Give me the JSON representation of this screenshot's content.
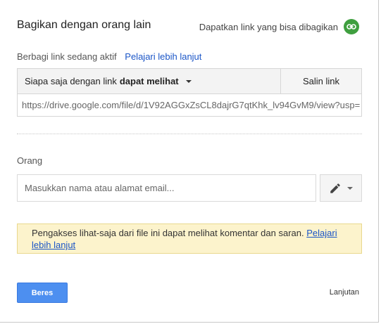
{
  "dialog": {
    "title": "Bagikan dengan orang lain",
    "get_link_label": "Dapatkan link yang bisa dibagikan",
    "link_icon_color": "#3f9f3f"
  },
  "link_sharing": {
    "status": "Berbagi link sedang aktif",
    "learn_more": "Pelajari lebih lanjut",
    "access_prefix": "Siapa saja dengan link",
    "access_level": "dapat melihat",
    "copy_button": "Salin link",
    "url": "https://drive.google.com/file/d/1V92AGGxZsCL8dajrG7qtKhk_lv94GvM9/view?usp="
  },
  "people": {
    "label": "Orang",
    "placeholder": "Masukkan nama atau alamat email..."
  },
  "notice": {
    "text": "Pengakses lihat-saja dari file ini dapat melihat komentar dan saran.",
    "link": "Pelajari lebih lanjut",
    "background": "#fcf3cc"
  },
  "footer": {
    "done_button": "Beres",
    "advanced_link": "Lanjutan",
    "primary_color": "#4d8ff0"
  }
}
